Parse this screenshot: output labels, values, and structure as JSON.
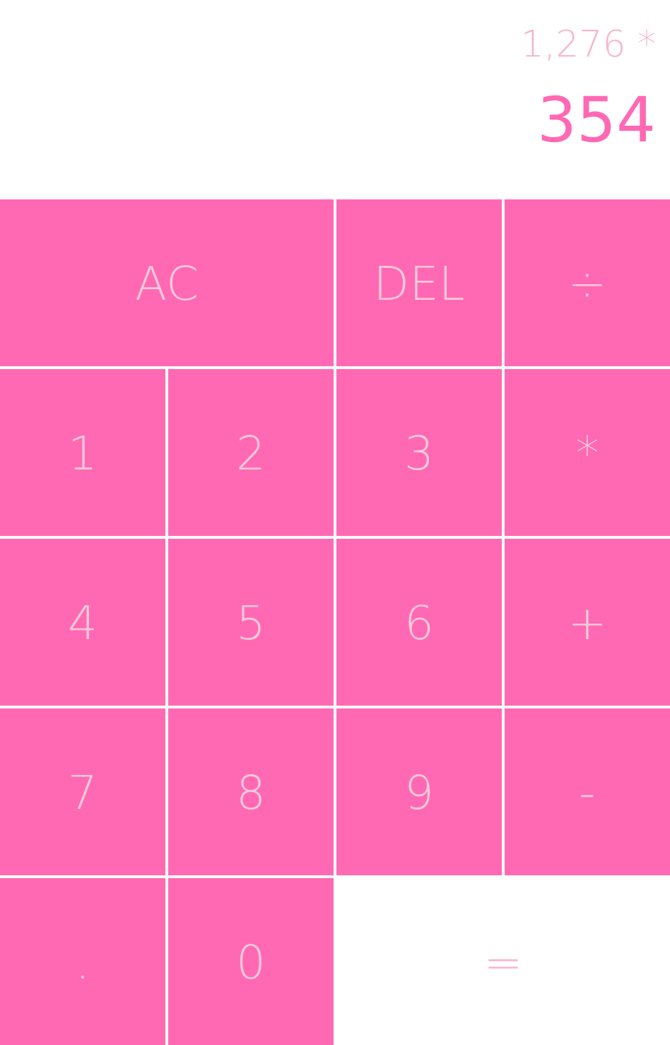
{
  "display": {
    "previous": "1,276 *",
    "current": "354"
  },
  "keys": [
    {
      "label": "AC",
      "kind": "wide"
    },
    {
      "label": "DEL",
      "kind": "key"
    },
    {
      "label": "÷",
      "kind": "key"
    },
    {
      "label": "1",
      "kind": "key"
    },
    {
      "label": "2",
      "kind": "key"
    },
    {
      "label": "3",
      "kind": "key"
    },
    {
      "label": "*",
      "kind": "key"
    },
    {
      "label": "4",
      "kind": "key"
    },
    {
      "label": "5",
      "kind": "key"
    },
    {
      "label": "6",
      "kind": "key"
    },
    {
      "label": "+",
      "kind": "key"
    },
    {
      "label": "7",
      "kind": "key"
    },
    {
      "label": "8",
      "kind": "key"
    },
    {
      "label": "9",
      "kind": "key"
    },
    {
      "label": "-",
      "kind": "key"
    },
    {
      "label": ".",
      "kind": "key"
    },
    {
      "label": "0",
      "kind": "key"
    },
    {
      "label": "=",
      "kind": "equals"
    }
  ]
}
